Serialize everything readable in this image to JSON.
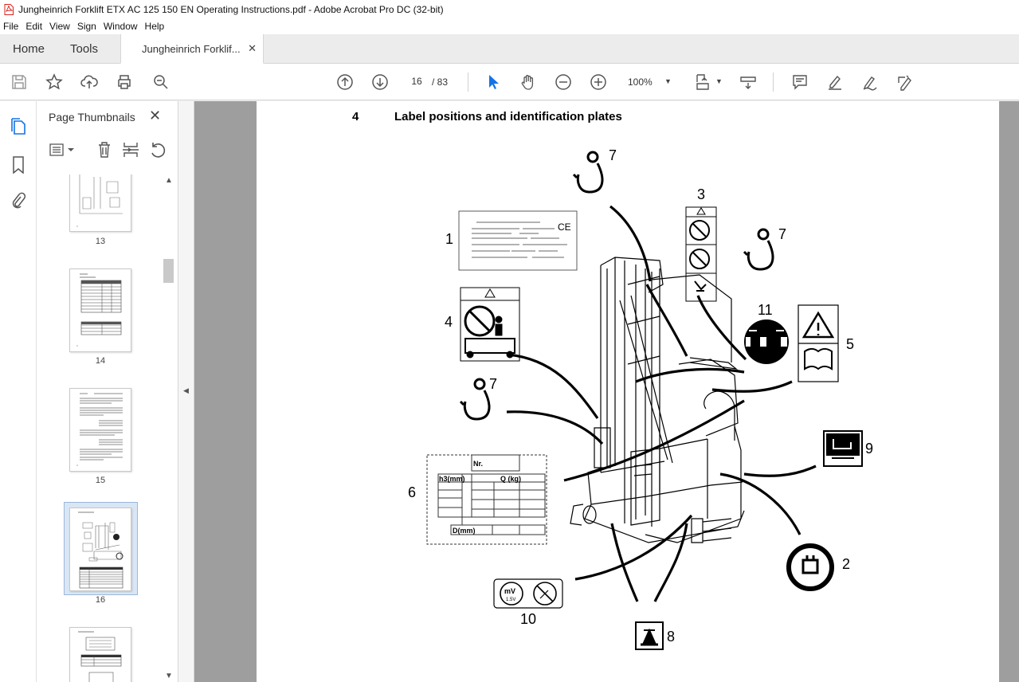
{
  "window": {
    "title": "Jungheinrich Forklift ETX AC 125 150 EN Operating Instructions.pdf - Adobe Acrobat Pro DC (32-bit)"
  },
  "menu": [
    "File",
    "Edit",
    "View",
    "Sign",
    "Window",
    "Help"
  ],
  "tabs": {
    "home": "Home",
    "tools": "Tools",
    "document": "Jungheinrich Forklif...",
    "close_glyph": "✕"
  },
  "toolbar": {
    "current_page": "16",
    "page_count": "/ 83",
    "zoom": "100%"
  },
  "thumbnails_panel": {
    "title": "Page Thumbnails",
    "close_glyph": "✕",
    "pages": [
      {
        "number": "13"
      },
      {
        "number": "14"
      },
      {
        "number": "15"
      },
      {
        "number": "16",
        "selected": true
      },
      {
        "number": ""
      }
    ]
  },
  "document": {
    "section_number": "4",
    "section_title": "Label positions and identification plates",
    "callouts": [
      "1",
      "2",
      "3",
      "4",
      "5",
      "6",
      "7",
      "7",
      "7",
      "8",
      "9",
      "10",
      "11"
    ],
    "table_labels": {
      "nr": "Nr.",
      "h3": "h3(mm)",
      "q": "Q (kg)",
      "d": "D(mm)",
      "mv": "mV",
      "mv_sub": "1.5V",
      "ce": "CE"
    }
  },
  "colors": {
    "accent": "#1473e6",
    "pdf_icon_red": "#d9221c",
    "doc_background": "#9e9e9e",
    "selected_thumb_bg": "#d9e6f4"
  }
}
